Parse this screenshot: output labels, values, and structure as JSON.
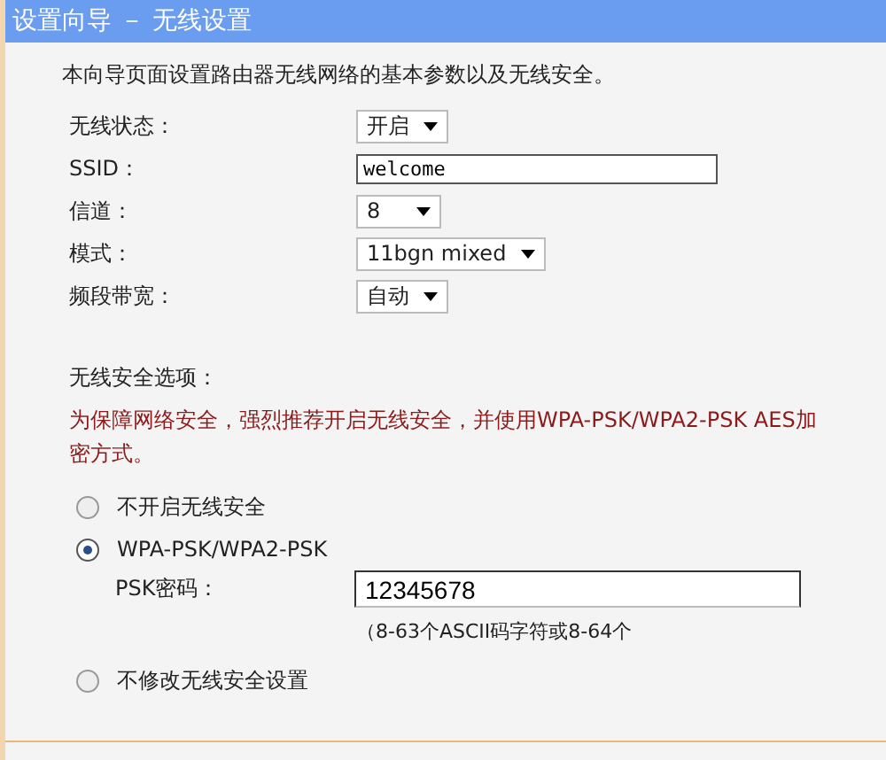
{
  "window": {
    "title": "设置向导 － 无线设置"
  },
  "intro": "本向导页面设置路由器无线网络的基本参数以及无线安全。",
  "fields": [
    {
      "kind": "select",
      "label": "无线状态：",
      "value": "开启"
    },
    {
      "kind": "text",
      "label": "SSID：",
      "value": "welcome"
    },
    {
      "kind": "select",
      "label": "信道：",
      "value": "8"
    },
    {
      "kind": "select",
      "label": "模式：",
      "value": "11bgn mixed"
    },
    {
      "kind": "select",
      "label": "频段带宽：",
      "value": "自动"
    }
  ],
  "security": {
    "heading": "无线安全选项：",
    "warning": "为保障网络安全，强烈推荐开启无线安全，并使用WPA-PSK/WPA2-PSK AES加密方式。",
    "options": [
      {
        "label": "不开启无线安全",
        "selected": false
      },
      {
        "label": "WPA-PSK/WPA2-PSK",
        "selected": true,
        "psk": {
          "label": "PSK密码：",
          "value": "12345678",
          "hint": "（8-63个ASCII码字符或8-64个"
        }
      },
      {
        "label": "不修改无线安全设置",
        "selected": false
      }
    ]
  }
}
